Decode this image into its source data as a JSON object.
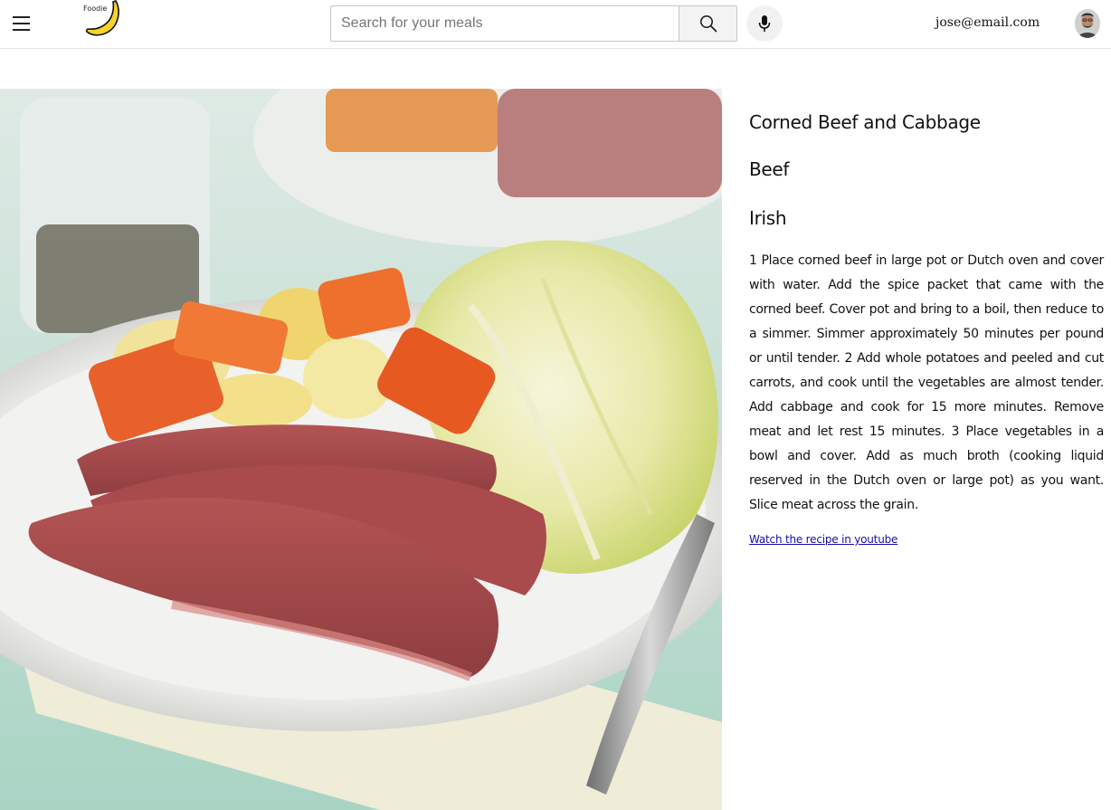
{
  "header": {
    "logo_text": "Foodie",
    "search_placeholder": "Search for your meals",
    "user_email": "jose@email.com"
  },
  "icons": {
    "menu": "hamburger-menu-icon",
    "logo": "banana-icon",
    "search": "search-icon",
    "mic": "microphone-icon",
    "avatar": "user-avatar"
  },
  "recipe": {
    "title": "Corned Beef and Cabbage",
    "category": "Beef",
    "area": "Irish",
    "instructions": "1 Place corned beef in large pot or Dutch oven and cover with water. Add the spice packet that came with the corned beef. Cover pot and bring to a boil, then reduce to a simmer. Simmer approximately 50 minutes per pound or until tender. 2 Add whole potatoes and peeled and cut carrots, and cook until the vegetables are almost tender. Add cabbage and cook for 15 more minutes. Remove meat and let rest 15 minutes. 3 Place vegetables in a bowl and cover. Add as much broth (cooking liquid reserved in the Dutch oven or large pot) as you want. Slice meat across the grain.",
    "youtube_link": "Watch the recipe in youtube"
  },
  "colors": {
    "link": "#1a0dab",
    "header_border": "#e3e3e3",
    "search_button_bg": "#f3f3f3",
    "banana_yellow": "#f6d32d"
  }
}
